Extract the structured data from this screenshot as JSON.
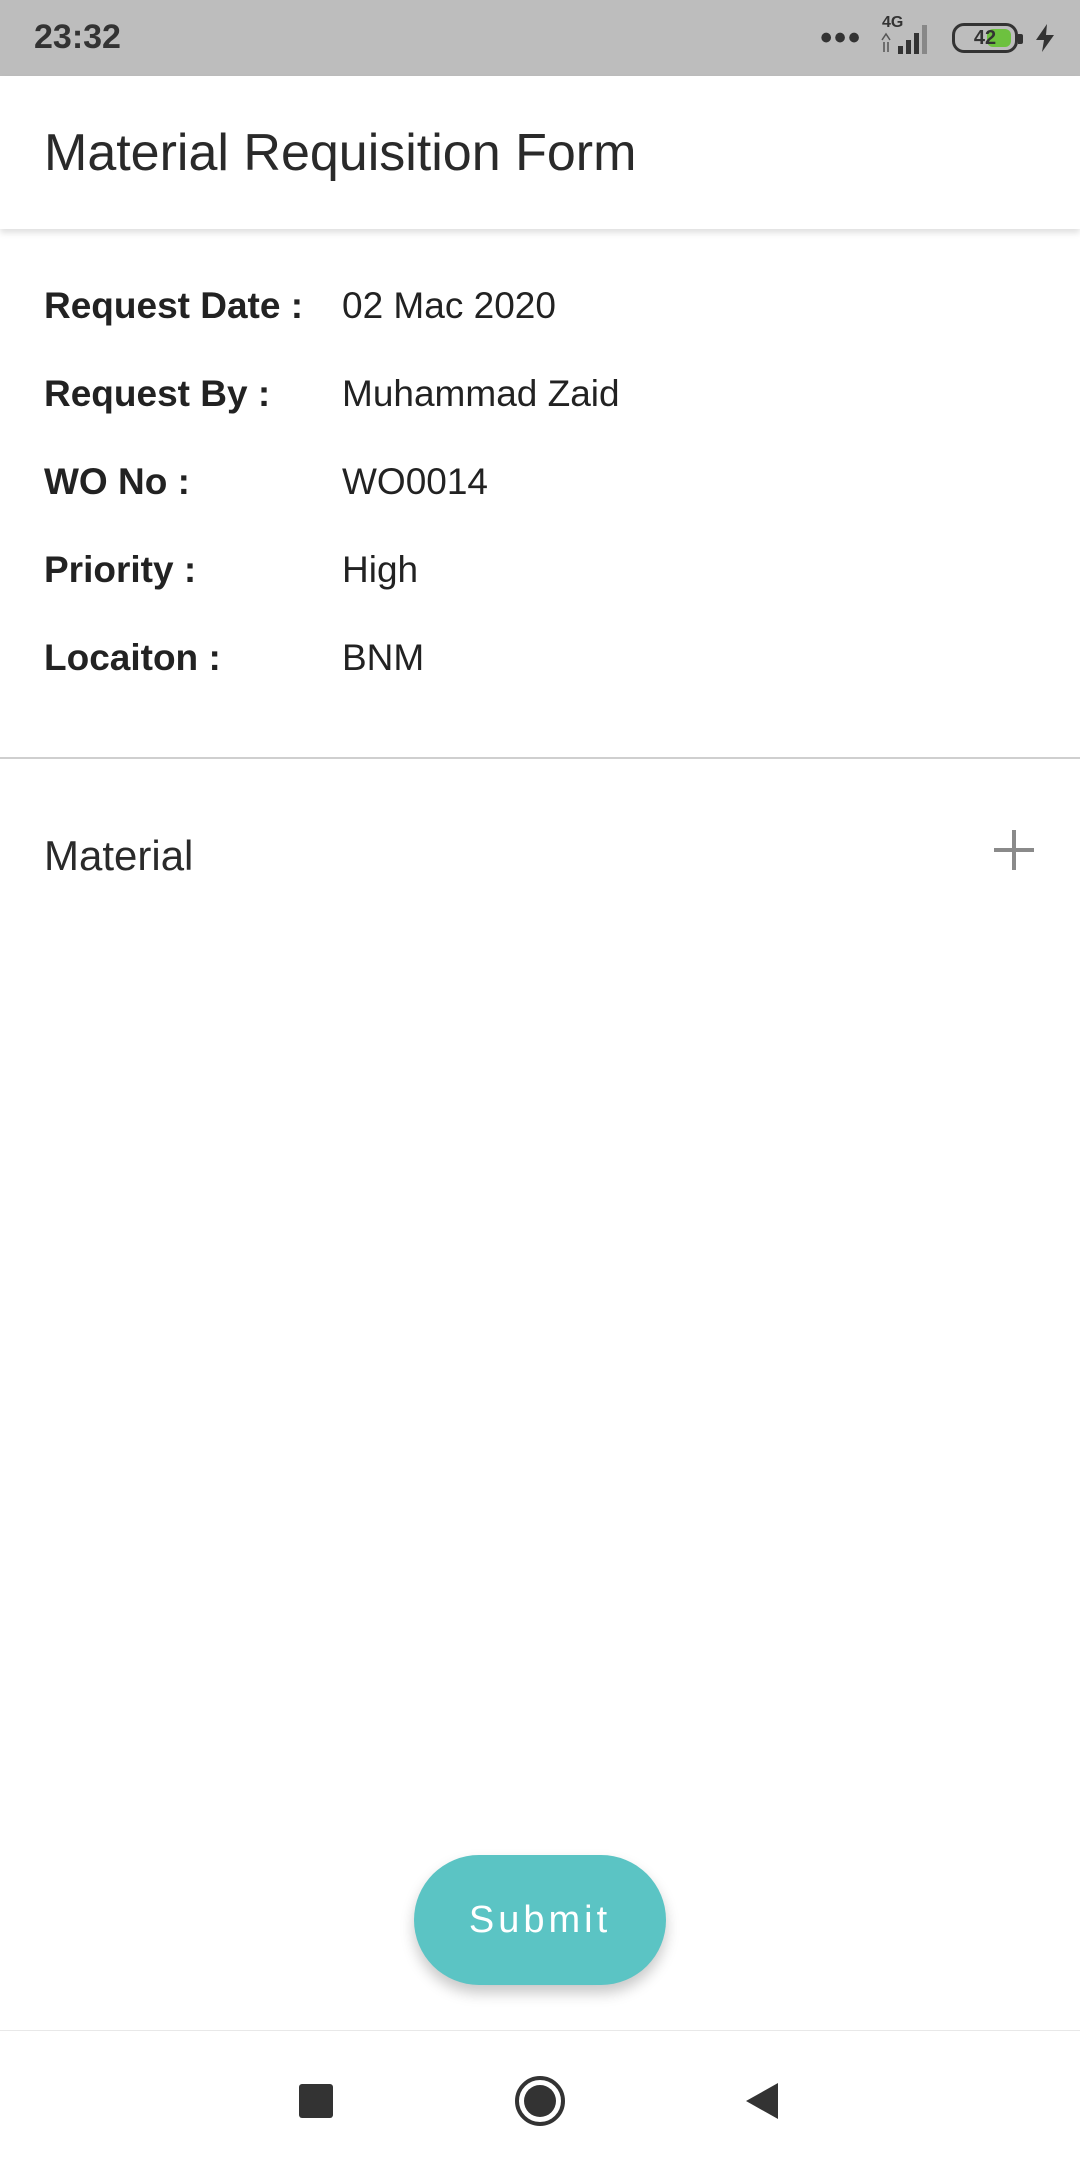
{
  "status_bar": {
    "time": "23:32",
    "network": "4G",
    "battery": "42",
    "icons": [
      "more-dots-icon",
      "signal-icon",
      "battery-icon",
      "charging-icon"
    ]
  },
  "header": {
    "title": "Material Requisition Form"
  },
  "details": [
    {
      "label": "Request Date :",
      "value": "02 Mac 2020"
    },
    {
      "label": "Request By :",
      "value": "Muhammad Zaid"
    },
    {
      "label": "WO No :",
      "value": "WO0014"
    },
    {
      "label": "Priority :",
      "value": "High"
    },
    {
      "label": "Locaiton :",
      "value": "BNM"
    }
  ],
  "material": {
    "label": "Material",
    "add_icon": "plus-icon"
  },
  "actions": {
    "submit_label": "Submit"
  },
  "nav_bar": {
    "icons": [
      "recents-square-icon",
      "home-circle-icon",
      "back-triangle-icon"
    ]
  },
  "colors": {
    "accent": "#5bc4c4",
    "status_bar_bg": "#bdbdbd",
    "battery_fill": "#6dc13f",
    "text": "#222222"
  }
}
